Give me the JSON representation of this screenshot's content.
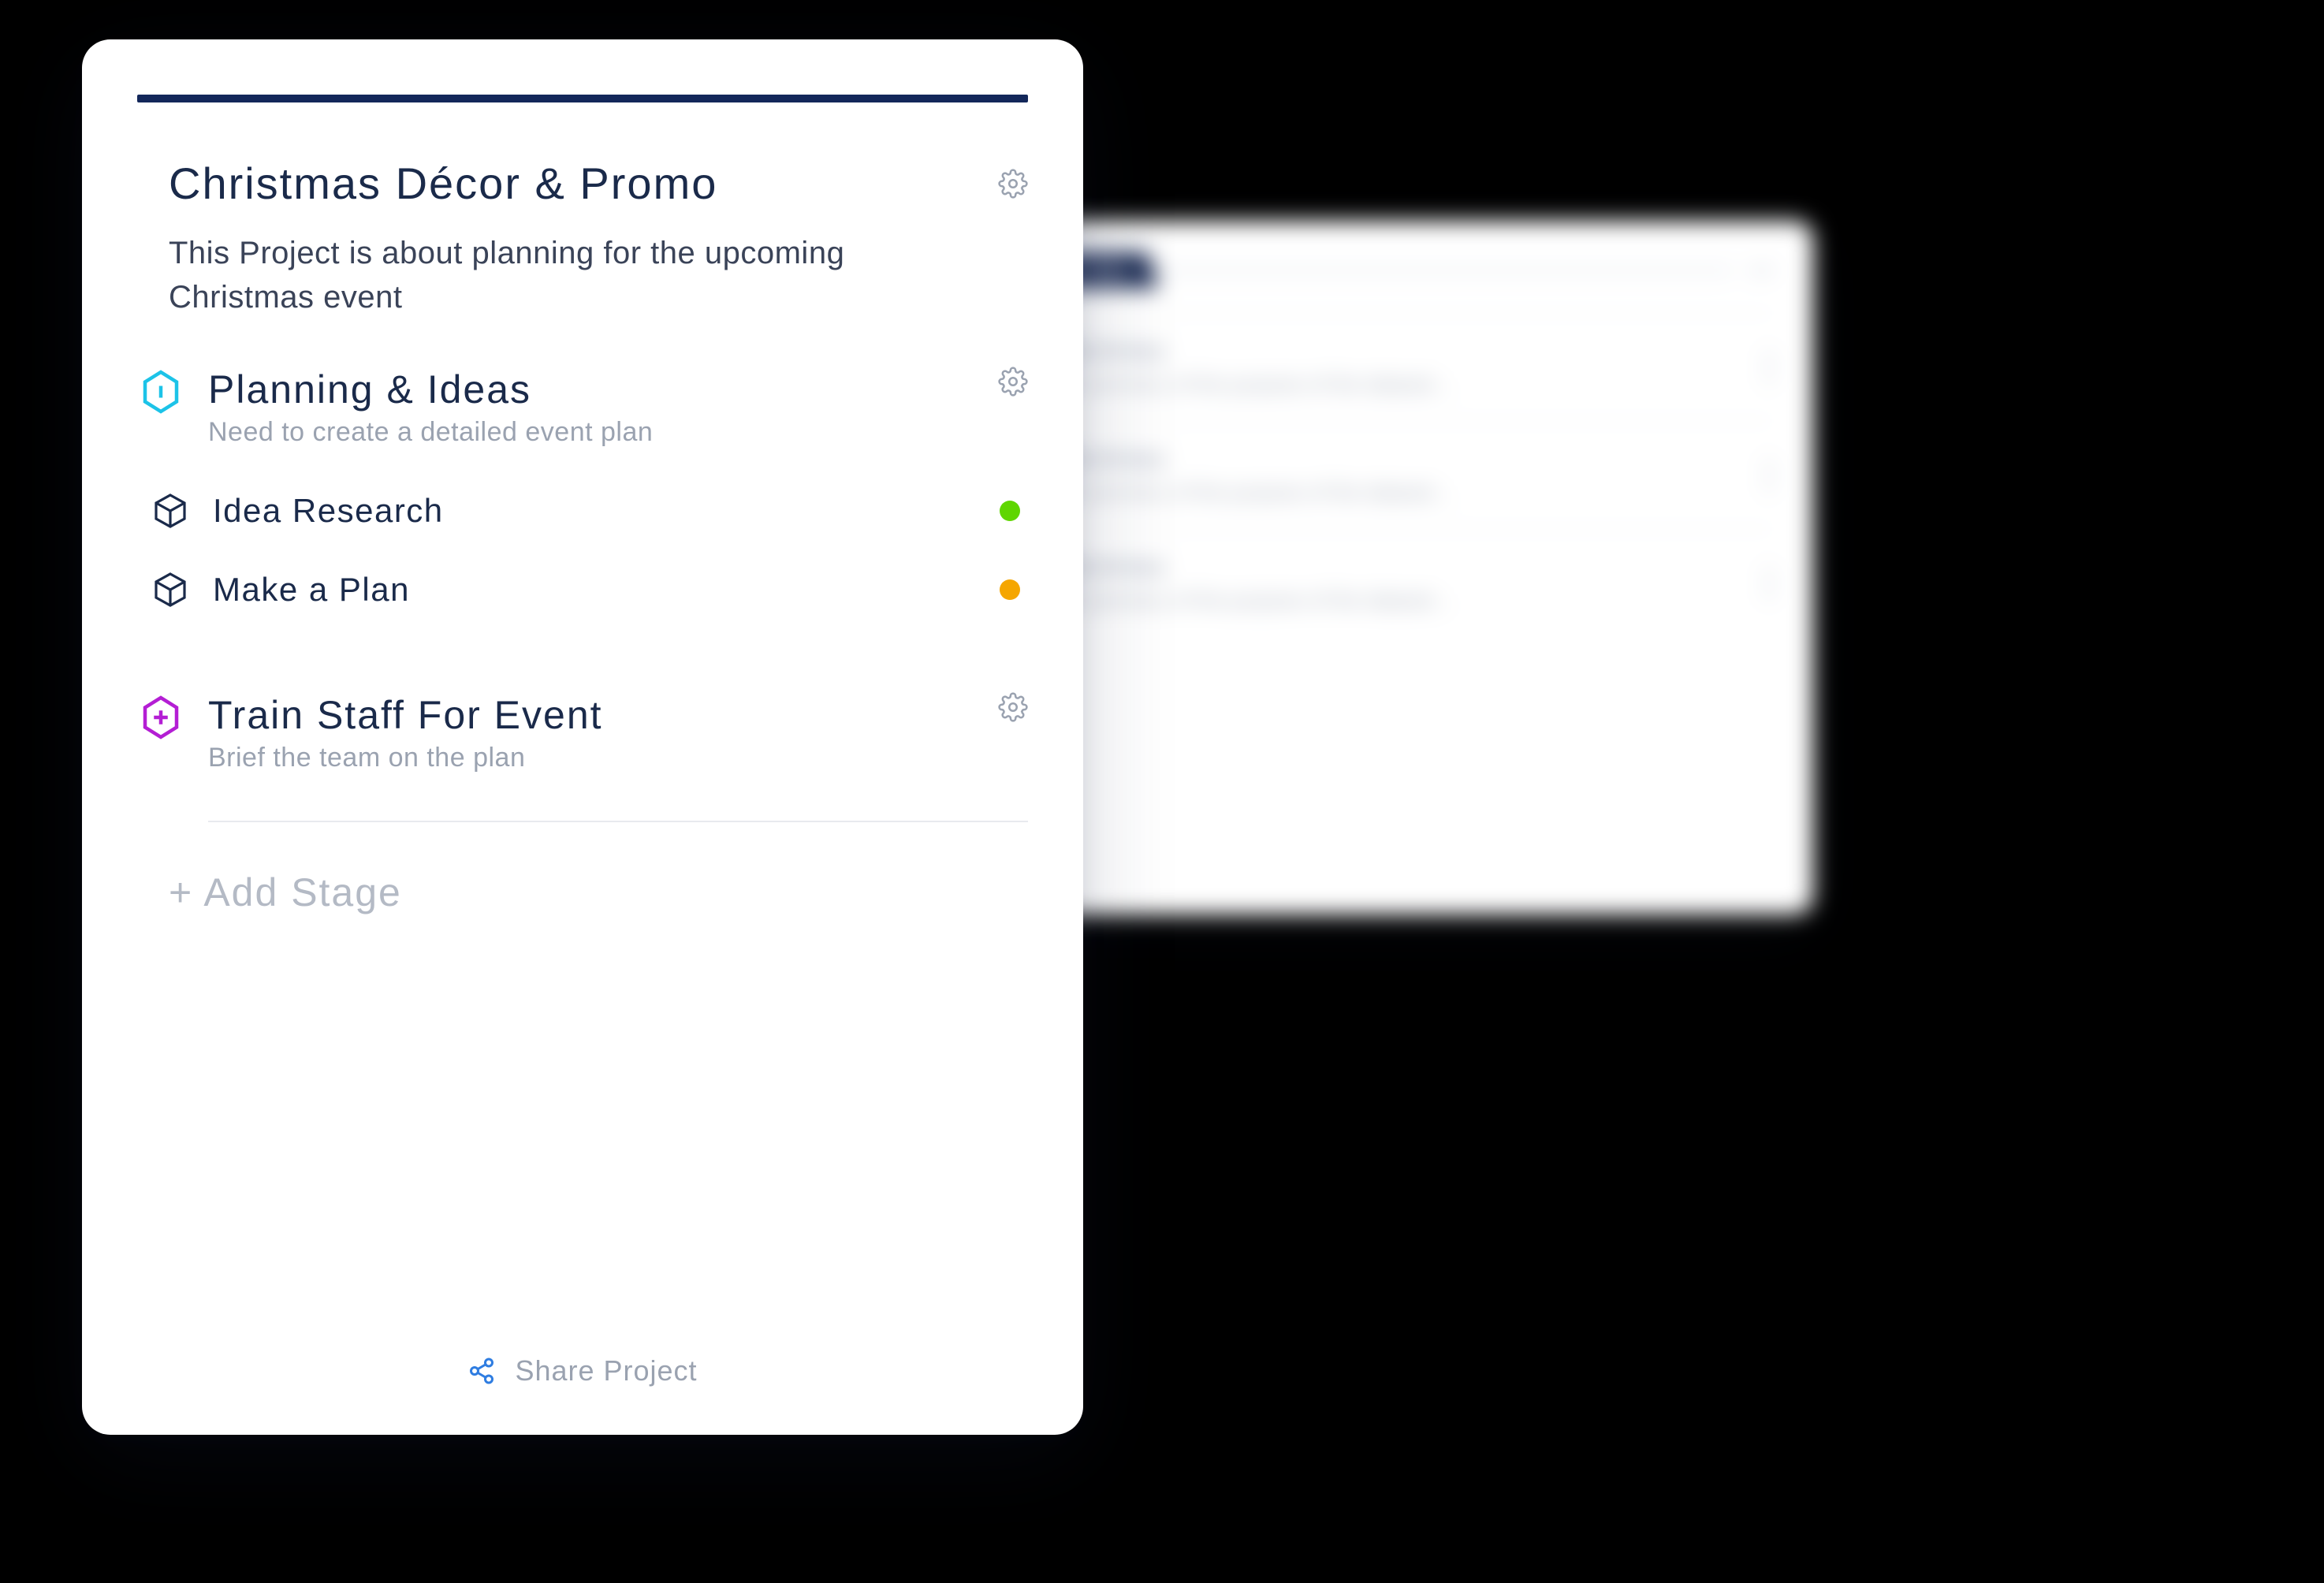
{
  "project": {
    "title": "Christmas Décor & Promo",
    "description": "This Project is about planning for the upcoming Christmas event"
  },
  "stages": [
    {
      "icon": "hex-info",
      "icon_color": "#1cc3e8",
      "title": "Planning & Ideas",
      "subtitle": "Need to create a detailed event plan",
      "tasks": [
        {
          "title": "Idea Research",
          "status_color": "#5fd600"
        },
        {
          "title": "Make a Plan",
          "status_color": "#f5a600"
        }
      ]
    },
    {
      "icon": "hex-plus",
      "icon_color": "#b41ed4",
      "title": "Train Staff For Event",
      "subtitle": "Brief the team on the plan",
      "tasks": []
    }
  ],
  "add_stage_label": "+ Add Stage",
  "share_label": "Share Project",
  "background_card": {
    "tab": "Tasks",
    "items": [
      {
        "title": "Summary",
        "desc": "A summary of the purpose of the dataset…"
      },
      {
        "title": "Summary",
        "desc": "A summary of the purpose of the dataset…"
      },
      {
        "title": "Summary",
        "desc": "A summary of the purpose of the dataset…"
      }
    ]
  }
}
